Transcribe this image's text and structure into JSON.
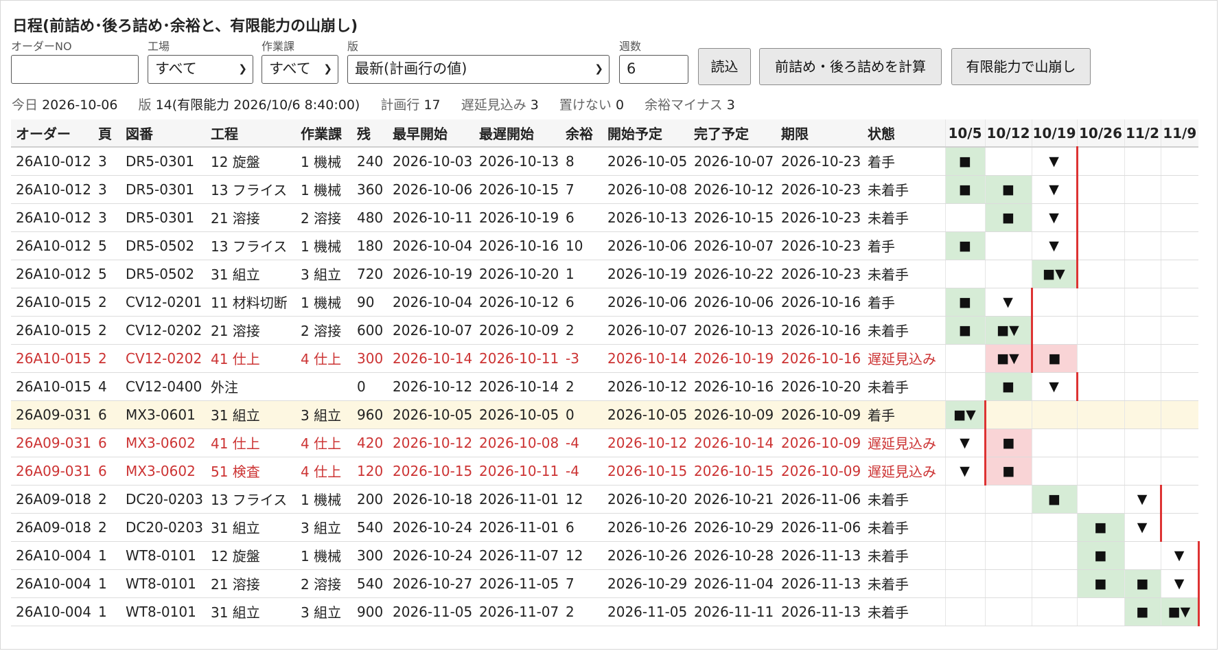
{
  "title": "日程(前詰め･後ろ詰め･余裕と、有限能力の山崩し)",
  "form": {
    "order_label": "オーダーNO",
    "order_value": "",
    "factory_label": "工場",
    "factory_value": "すべて",
    "section_label": "作業課",
    "section_value": "すべて",
    "version_label": "版",
    "version_value": "最新(計画行の値)",
    "weeks_label": "週数",
    "weeks_value": "6",
    "load_button": "読込",
    "calc_button": "前詰め・後ろ詰めを計算",
    "level_button": "有限能力で山崩し"
  },
  "info": {
    "today_label": "今日",
    "today_value": "2026-10-06",
    "version_label": "版",
    "version_value": "14(有限能力 2026/10/6 8:40:00)",
    "plan_rows_label": "計画行",
    "plan_rows_value": "17",
    "delay_label": "遅延見込み",
    "delay_value": "3",
    "unplaced_label": "置けない",
    "unplaced_value": "0",
    "slack_minus_label": "余裕マイナス",
    "slack_minus_value": "3"
  },
  "columns": [
    "オーダー",
    "頁",
    "図番",
    "工程",
    "作業課",
    "残",
    "最早開始",
    "最遅開始",
    "余裕",
    "開始予定",
    "完了予定",
    "期限",
    "状態"
  ],
  "weeks": [
    "10/5",
    "10/12",
    "10/19",
    "10/26",
    "11/2",
    "11/9"
  ],
  "rows": [
    {
      "cells": [
        "26A10-012",
        "3",
        "DR5-0301",
        "12 旋盤",
        "1 機械",
        "240",
        "2026-10-03",
        "2026-10-13",
        "8",
        "2026-10-05",
        "2026-10-07",
        "2026-10-23",
        "着手"
      ],
      "marks": [
        "■",
        "",
        "▼",
        "",
        "",
        ""
      ],
      "fills": [
        "g",
        "",
        "",
        "",
        "",
        ""
      ],
      "deadline": 2,
      "late": false,
      "hl": false
    },
    {
      "cells": [
        "26A10-012",
        "3",
        "DR5-0301",
        "13 フライス",
        "1 機械",
        "360",
        "2026-10-06",
        "2026-10-15",
        "7",
        "2026-10-08",
        "2026-10-12",
        "2026-10-23",
        "未着手"
      ],
      "marks": [
        "■",
        "■",
        "▼",
        "",
        "",
        ""
      ],
      "fills": [
        "g",
        "g",
        "",
        "",
        "",
        ""
      ],
      "deadline": 2,
      "late": false,
      "hl": false
    },
    {
      "cells": [
        "26A10-012",
        "3",
        "DR5-0301",
        "21 溶接",
        "2 溶接",
        "480",
        "2026-10-11",
        "2026-10-19",
        "6",
        "2026-10-13",
        "2026-10-15",
        "2026-10-23",
        "未着手"
      ],
      "marks": [
        "",
        "■",
        "▼",
        "",
        "",
        ""
      ],
      "fills": [
        "",
        "g",
        "",
        "",
        "",
        ""
      ],
      "deadline": 2,
      "late": false,
      "hl": false
    },
    {
      "cells": [
        "26A10-012",
        "5",
        "DR5-0502",
        "13 フライス",
        "1 機械",
        "180",
        "2026-10-04",
        "2026-10-16",
        "10",
        "2026-10-06",
        "2026-10-07",
        "2026-10-23",
        "着手"
      ],
      "marks": [
        "■",
        "",
        "▼",
        "",
        "",
        ""
      ],
      "fills": [
        "g",
        "",
        "",
        "",
        "",
        ""
      ],
      "deadline": 2,
      "late": false,
      "hl": false
    },
    {
      "cells": [
        "26A10-012",
        "5",
        "DR5-0502",
        "31 組立",
        "3 組立",
        "720",
        "2026-10-19",
        "2026-10-20",
        "1",
        "2026-10-19",
        "2026-10-22",
        "2026-10-23",
        "未着手"
      ],
      "marks": [
        "",
        "",
        "■▼",
        "",
        "",
        ""
      ],
      "fills": [
        "",
        "",
        "g",
        "",
        "",
        ""
      ],
      "deadline": 2,
      "late": false,
      "hl": false
    },
    {
      "cells": [
        "26A10-015",
        "2",
        "CV12-0201",
        "11 材料切断",
        "1 機械",
        "90",
        "2026-10-04",
        "2026-10-12",
        "6",
        "2026-10-06",
        "2026-10-06",
        "2026-10-16",
        "着手"
      ],
      "marks": [
        "■",
        "▼",
        "",
        "",
        "",
        ""
      ],
      "fills": [
        "g",
        "",
        "",
        "",
        "",
        ""
      ],
      "deadline": 1,
      "late": false,
      "hl": false
    },
    {
      "cells": [
        "26A10-015",
        "2",
        "CV12-0202",
        "21 溶接",
        "2 溶接",
        "600",
        "2026-10-07",
        "2026-10-09",
        "2",
        "2026-10-07",
        "2026-10-13",
        "2026-10-16",
        "未着手"
      ],
      "marks": [
        "■",
        "■▼",
        "",
        "",
        "",
        ""
      ],
      "fills": [
        "g",
        "g",
        "",
        "",
        "",
        ""
      ],
      "deadline": 1,
      "late": false,
      "hl": false
    },
    {
      "cells": [
        "26A10-015",
        "2",
        "CV12-0202",
        "41 仕上",
        "4 仕上",
        "300",
        "2026-10-14",
        "2026-10-11",
        "-3",
        "2026-10-14",
        "2026-10-19",
        "2026-10-16",
        "遅延見込み"
      ],
      "marks": [
        "",
        "■▼",
        "■",
        "",
        "",
        ""
      ],
      "fills": [
        "",
        "p",
        "p",
        "",
        "",
        ""
      ],
      "deadline": 1,
      "late": true,
      "hl": false
    },
    {
      "cells": [
        "26A10-015",
        "4",
        "CV12-0400",
        "外注",
        "",
        "0",
        "2026-10-12",
        "2026-10-14",
        "2",
        "2026-10-12",
        "2026-10-16",
        "2026-10-20",
        "未着手"
      ],
      "marks": [
        "",
        "■",
        "▼",
        "",
        "",
        ""
      ],
      "fills": [
        "",
        "g",
        "",
        "",
        "",
        ""
      ],
      "deadline": 2,
      "late": false,
      "hl": false
    },
    {
      "cells": [
        "26A09-031",
        "6",
        "MX3-0601",
        "31 組立",
        "3 組立",
        "960",
        "2026-10-05",
        "2026-10-05",
        "0",
        "2026-10-05",
        "2026-10-09",
        "2026-10-09",
        "着手"
      ],
      "marks": [
        "■▼",
        "",
        "",
        "",
        "",
        ""
      ],
      "fills": [
        "g",
        "",
        "",
        "",
        "",
        ""
      ],
      "deadline": 0,
      "late": false,
      "hl": true
    },
    {
      "cells": [
        "26A09-031",
        "6",
        "MX3-0602",
        "41 仕上",
        "4 仕上",
        "420",
        "2026-10-12",
        "2026-10-08",
        "-4",
        "2026-10-12",
        "2026-10-14",
        "2026-10-09",
        "遅延見込み"
      ],
      "marks": [
        "▼",
        "■",
        "",
        "",
        "",
        ""
      ],
      "fills": [
        "",
        "p",
        "",
        "",
        "",
        ""
      ],
      "deadline": 0,
      "late": true,
      "hl": false
    },
    {
      "cells": [
        "26A09-031",
        "6",
        "MX3-0602",
        "51 検査",
        "4 仕上",
        "120",
        "2026-10-15",
        "2026-10-11",
        "-4",
        "2026-10-15",
        "2026-10-15",
        "2026-10-09",
        "遅延見込み"
      ],
      "marks": [
        "▼",
        "■",
        "",
        "",
        "",
        ""
      ],
      "fills": [
        "",
        "p",
        "",
        "",
        "",
        ""
      ],
      "deadline": 0,
      "late": true,
      "hl": false
    },
    {
      "cells": [
        "26A09-018",
        "2",
        "DC20-0203",
        "13 フライス",
        "1 機械",
        "200",
        "2026-10-18",
        "2026-11-01",
        "12",
        "2026-10-20",
        "2026-10-21",
        "2026-11-06",
        "未着手"
      ],
      "marks": [
        "",
        "",
        "■",
        "",
        "▼",
        ""
      ],
      "fills": [
        "",
        "",
        "g",
        "",
        "",
        ""
      ],
      "deadline": 4,
      "late": false,
      "hl": false
    },
    {
      "cells": [
        "26A09-018",
        "2",
        "DC20-0203",
        "31 組立",
        "3 組立",
        "540",
        "2026-10-24",
        "2026-11-01",
        "6",
        "2026-10-26",
        "2026-10-29",
        "2026-11-06",
        "未着手"
      ],
      "marks": [
        "",
        "",
        "",
        "■",
        "▼",
        ""
      ],
      "fills": [
        "",
        "",
        "",
        "g",
        "",
        ""
      ],
      "deadline": 4,
      "late": false,
      "hl": false
    },
    {
      "cells": [
        "26A10-004",
        "1",
        "WT8-0101",
        "12 旋盤",
        "1 機械",
        "300",
        "2026-10-24",
        "2026-11-07",
        "12",
        "2026-10-26",
        "2026-10-28",
        "2026-11-13",
        "未着手"
      ],
      "marks": [
        "",
        "",
        "",
        "■",
        "",
        "▼"
      ],
      "fills": [
        "",
        "",
        "",
        "g",
        "",
        ""
      ],
      "deadline": 5,
      "late": false,
      "hl": false
    },
    {
      "cells": [
        "26A10-004",
        "1",
        "WT8-0101",
        "21 溶接",
        "2 溶接",
        "540",
        "2026-10-27",
        "2026-11-05",
        "7",
        "2026-10-29",
        "2026-11-04",
        "2026-11-13",
        "未着手"
      ],
      "marks": [
        "",
        "",
        "",
        "■",
        "■",
        "▼"
      ],
      "fills": [
        "",
        "",
        "",
        "g",
        "g",
        ""
      ],
      "deadline": 5,
      "late": false,
      "hl": false
    },
    {
      "cells": [
        "26A10-004",
        "1",
        "WT8-0101",
        "31 組立",
        "3 組立",
        "900",
        "2026-11-05",
        "2026-11-07",
        "2",
        "2026-11-05",
        "2026-11-11",
        "2026-11-13",
        "未着手"
      ],
      "marks": [
        "",
        "",
        "",
        "",
        "■",
        "■▼"
      ],
      "fills": [
        "",
        "",
        "",
        "",
        "g",
        "g"
      ],
      "deadline": 5,
      "late": false,
      "hl": false
    }
  ]
}
